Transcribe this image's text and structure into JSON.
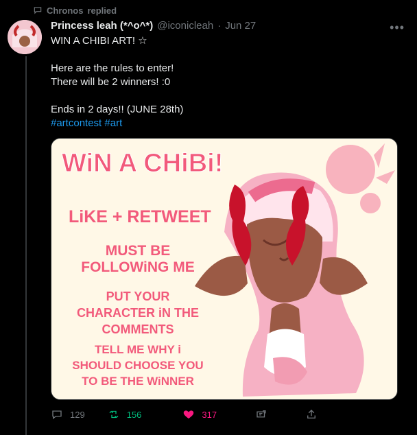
{
  "context": {
    "user": "Chronos",
    "action": "replied"
  },
  "tweet": {
    "name": "Princess leah (*^o^*)",
    "handle": "@iconicleah",
    "separator": "·",
    "date": "Jun 27",
    "text": "WIN A CHIBI ART! ☆\n\nHere are the rules to enter!\nThere will be 2 winners! :0\n\nEnds in 2 days!! (JUNE 28th)",
    "hashtags": [
      "#artcontest",
      "#art"
    ],
    "media": {
      "title": "WiN A CHiBi!",
      "rules": [
        "LiKE + RETWEET",
        "MUST BE FOLLOWiNG ME",
        "PUT YOUR CHARACTER iN THE COMMENTS",
        "TELL ME WHY i SHOULD CHOOSE YOU TO BE THE WiNNER"
      ],
      "rule_lines": {
        "r1": [
          "LiKE + RETWEET"
        ],
        "r2": [
          "MUST BE",
          "FOLLOWiNG ME"
        ],
        "r3": [
          "PUT YOUR",
          "CHARACTER iN THE",
          "COMMENTS"
        ],
        "r4": [
          "TELL ME WHY i",
          "SHOULD CHOOSE YOU",
          "TO BE THE WiNNER"
        ]
      }
    },
    "metrics": {
      "replies": "129",
      "retweets": "156",
      "likes": "317"
    }
  },
  "icons": {
    "context": "speech-bubble-icon",
    "reply": "reply-icon",
    "retweet": "retweet-icon",
    "like": "heart-icon",
    "share": "share-icon",
    "upload": "upload-icon",
    "more": "more-icon"
  },
  "colors": {
    "retweet": "#00ba7c",
    "like": "#f91880",
    "hashtag": "#1d9bf0",
    "muted": "#71767b",
    "poster_pink": "#f25a7b",
    "poster_bg": "#fff8e7"
  }
}
